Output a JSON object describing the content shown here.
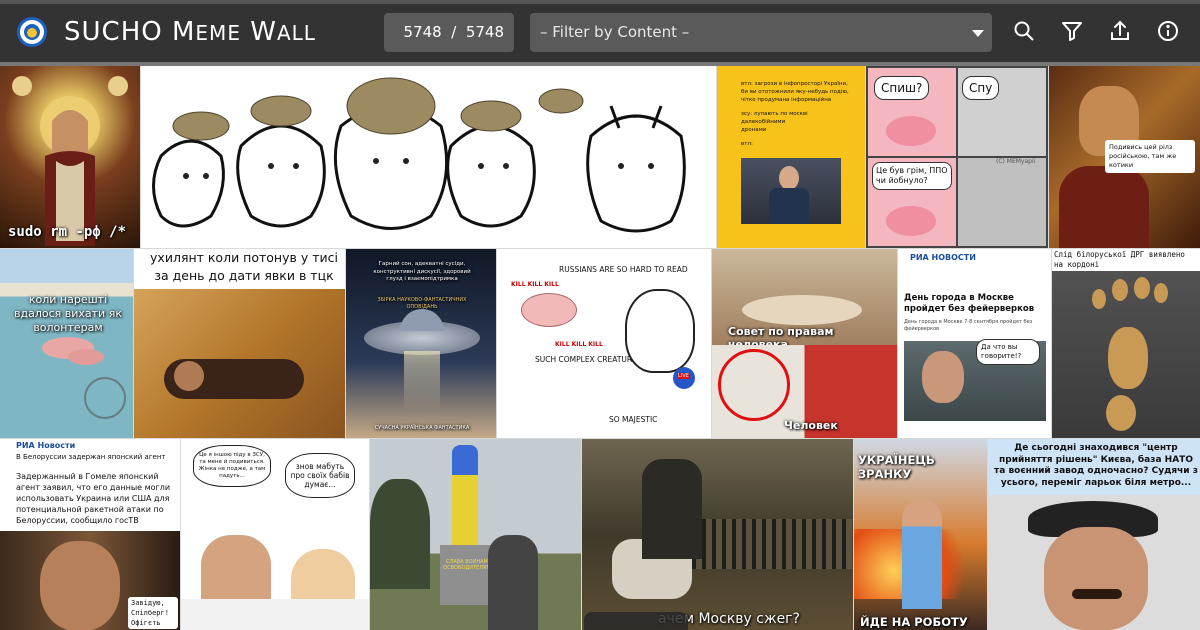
{
  "app": {
    "title_big1": "SUCHO",
    "title_big2": "M",
    "title_small2": "EME",
    "title_big3": "W",
    "title_small3": "ALL",
    "counter": "5748  /  5748",
    "filter_label": "– Filter by Content –"
  },
  "icons": [
    "search-icon",
    "filter-icon",
    "share-icon",
    "info-icon"
  ],
  "colors": {
    "topbar": "#333333",
    "control": "#5a5a5a",
    "accent_yellow": "#f7c21a"
  },
  "tiles": {
    "t1": {
      "caption": "sudo rm -рф /*"
    },
    "t3": {
      "line1": "втл: загрози в інфопросторі України,",
      "line2": "би ви ототожнили яку-небудь подію,",
      "line3": "чітко продумана інформаційна",
      "line4": "зсу: лупають по москві далекобійними",
      "line5": "дронами",
      "line6": "втл:"
    },
    "t4": {
      "b1": "Спиш?",
      "b2": "Спу",
      "b3": "Це був грім, ППО чи йобнуло?",
      "wm": "(C) МЕМуарії"
    },
    "t5": {
      "bubble": "Подивись цей рілз російською, там же котики"
    },
    "t6": {
      "caption": "коли нарешті вдалося вихати як волонтерам"
    },
    "t7": {
      "caption": "ухилянт коли потонув у тисі за день до дати явки в тцк"
    },
    "t8": {
      "intro": "Гарний сон, адекватні сусіди, конструктивні дискусії, здоровий глузд і взаємопідтримка",
      "band": "ЗБІРКА НАУКОВО-ФАНТАСТИЧНИХ ОПОВІДАНЬ",
      "footer": "СУЧАСНА УКРАЇНСЬКА ФАНТАСТИКА"
    },
    "t9": {
      "header": "RUSSIANS ARE SO HARD TO READ",
      "k1": "KILL KILL KILL",
      "k2": "KILL KILL KILL",
      "mid": "SUCH COMPLEX CREATURES",
      "bottom": "SO MAJESTIC",
      "live": "LIVE"
    },
    "t10": {
      "top": "Совет по правам человека",
      "bottom": "Человек"
    },
    "t11": {
      "brand": "РИА НОВОСТИ",
      "headline": "День города в Москве пройдет без фейерверков",
      "sub": "День города в Москве 7-8 сентября пройдет без фейерверков",
      "bubble": "Да что вы говорите!?"
    },
    "t12": {
      "caption": "Слід білоруської ДРГ виявлено на кордоні"
    },
    "t13": {
      "brand": "РИА Новости",
      "headline": "В Белоруссии задержан японский агент",
      "body": "Задержанный в Гомеле японский агент заявил, что его данные могли использовать Украина или США для потенциальной ракетной атаки по Белоруссии, сообщило госТВ",
      "bottom": "Завідую, Спілберг! Офігєть"
    },
    "t14": {
      "left": "Це я іншою піду в ЗСУ, та мене й подивиться. Жінка не подже, а там падуть...",
      "right": "знов мабуть про своїх бабів думає..."
    },
    "t15": {
      "sign": "СЛАВА ВОИНАМ ОСВОБОДИТЕЛЯМ"
    },
    "t16": {
      "caption": "ачем Москву сжег?"
    },
    "t17": {
      "top": "УКРАЇНЕЦЬ ЗРАНКУ",
      "bottom": "ЙДЕ НА РОБОТУ"
    },
    "t18": {
      "caption": "Де сьогодні знаходився \"центр прийняття рішень\" Києва, база НАТО та воєнний завод одночасно? Судячи з усього, переміг ларьок біля метро..."
    }
  }
}
